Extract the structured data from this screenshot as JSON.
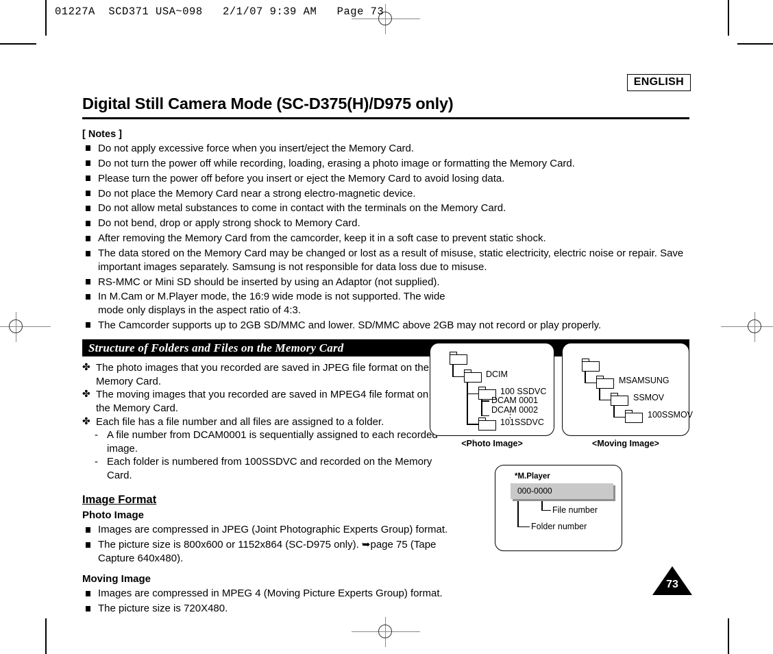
{
  "sheet": {
    "imposition_header": "01227A  SCD371 USA~098   2/1/07 9:39 AM   Page 73"
  },
  "header": {
    "language_badge": "ENGLISH",
    "title": "Digital Still Camera Mode (SC-D375(H)/D975 only)"
  },
  "notes": {
    "label": "[ Notes ]",
    "items": [
      "Do not apply excessive force when you insert/eject the Memory Card.",
      "Do not turn the power off while recording, loading, erasing a photo image or formatting the Memory Card.",
      "Please turn the power off before you insert or eject the Memory Card to avoid losing data.",
      "Do not place the Memory Card near a strong electro-magnetic device.",
      "Do not allow metal substances to come in contact with the terminals on the Memory Card.",
      "Do not bend, drop or apply strong shock to Memory Card.",
      "After removing the Memory Card from the camcorder, keep it in a soft case to prevent static shock.",
      "The data stored on the Memory Card may be changed or lost as a result of misuse, static electricity, electric noise or repair. Save important images separately. Samsung is not responsible for data loss due to misuse.",
      "RS-MMC or Mini SD should be inserted by using an Adaptor (not supplied).",
      "In M.Cam or M.Player mode, the 16:9 wide mode is not supported. The wide mode only displays in the aspect ratio of 4:3.",
      "The Camcorder supports up to 2GB SD/MMC and lower. SD/MMC above 2GB may not record or play properly."
    ]
  },
  "structure_section": {
    "bar_title": "Structure of Folders and Files on the Memory Card",
    "club_items": [
      "The photo images that you recorded are saved in JPEG file format on the Memory Card.",
      "The moving images that you recorded are saved in MPEG4 file format on the Memory Card.",
      "Each file has a file number and all files are assigned to a folder."
    ],
    "dash_items": [
      "A file number from DCAM0001 is sequentially assigned to each recorded image.",
      "Each folder is numbered from 100SSDVC and recorded on the Memory Card."
    ],
    "club_glyph": "✤",
    "dash_glyph": "-"
  },
  "photo_diagram": {
    "caption": "<Photo Image>",
    "labels": {
      "dcim": "DCIM",
      "folder_100": "100 SSDVC",
      "file_1": "DCAM 0001",
      "file_2": "DCAM 0002",
      "ellipsis": "⋮",
      "folder_101": "101SSDVC"
    }
  },
  "moving_diagram": {
    "caption": "<Moving Image>",
    "labels": {
      "msamsung": "MSAMSUNG",
      "ssmov": "SSMOV",
      "folder_100": "100SSMOV"
    }
  },
  "mplayer_diagram": {
    "title": "*M.Player",
    "display_value": "000-0000",
    "file_number_label": "File number",
    "folder_number_label": "Folder number"
  },
  "image_format": {
    "heading": "Image Format",
    "photo_heading": "Photo Image",
    "photo_items": [
      "Images are compressed in JPEG (Joint Photographic Experts Group) format.",
      "The picture size is 800x600 or 1152x864 (SC-D975 only). ➥page 75 (Tape Capture 640x480)."
    ],
    "moving_heading": "Moving Image",
    "moving_items": [
      "Images are compressed in MPEG 4 (Moving Picture Experts Group) format.",
      "The picture size is 720X480."
    ]
  },
  "footer": {
    "page_number": "73"
  }
}
